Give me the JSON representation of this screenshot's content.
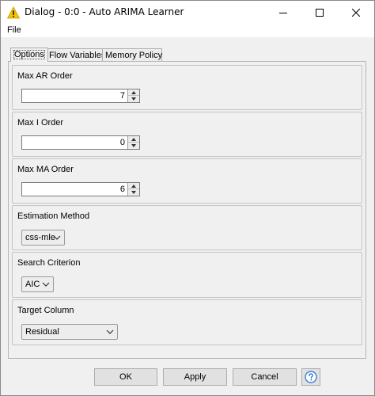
{
  "window": {
    "title": "Dialog - 0:0 - Auto ARIMA Learner",
    "icon": "warning-triangle-icon",
    "controls": [
      "minimize-icon",
      "maximize-icon",
      "close-icon"
    ]
  },
  "menu": {
    "file_label": "File"
  },
  "tabs": [
    {
      "label": "Options",
      "active": true
    },
    {
      "label": "Flow Variables",
      "active": false
    },
    {
      "label": "Memory Policy",
      "active": false
    }
  ],
  "options": {
    "max_ar": {
      "label": "Max AR Order",
      "value": "7"
    },
    "max_i": {
      "label": "Max I Order",
      "value": "0"
    },
    "max_ma": {
      "label": "Max MA Order",
      "value": "6"
    },
    "estimation": {
      "label": "Estimation Method",
      "selected": "css-mle"
    },
    "criterion": {
      "label": "Search Criterion",
      "selected": "AIC"
    },
    "target": {
      "label": "Target Column",
      "selected": "Residual"
    }
  },
  "buttons": {
    "ok": "OK",
    "apply": "Apply",
    "cancel": "Cancel",
    "help_icon": "help-question-icon"
  },
  "colors": {
    "help_icon": "#3c7fd8",
    "warning_icon": "#f5c400"
  }
}
